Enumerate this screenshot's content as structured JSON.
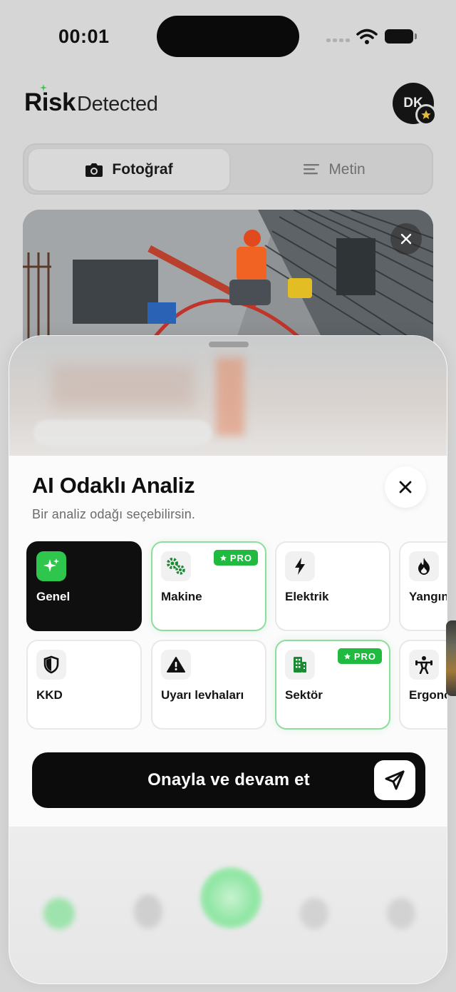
{
  "status_bar": {
    "time": "00:01"
  },
  "header": {
    "logo_part1": "Risk",
    "logo_part2": "Detected",
    "avatar_initials": "DK"
  },
  "segmented": {
    "photo_label": "Fotoğraf",
    "text_label": "Metin"
  },
  "sheet": {
    "title": "AI Odaklı Analiz",
    "subtitle": "Bir analiz odağı seçebilirsin.",
    "options": [
      {
        "label": "Genel",
        "icon": "sparkles-icon",
        "selected": true,
        "pro": false
      },
      {
        "label": "Makine",
        "icon": "gears-icon",
        "selected": false,
        "pro": true
      },
      {
        "label": "Elektrik",
        "icon": "bolt-icon",
        "selected": false,
        "pro": false
      },
      {
        "label": "Yangın",
        "icon": "flame-icon",
        "selected": false,
        "pro": false
      },
      {
        "label": "KKD",
        "icon": "shield-icon",
        "selected": false,
        "pro": false
      },
      {
        "label": "Uyarı levhaları",
        "icon": "warning-icon",
        "selected": false,
        "pro": false
      },
      {
        "label": "Sektör",
        "icon": "building-icon",
        "selected": false,
        "pro": true
      },
      {
        "label": "Ergonomi",
        "icon": "person-lifting-icon",
        "selected": false,
        "pro": false
      }
    ],
    "pro_label": "PRO",
    "confirm_label": "Onayla ve devam et"
  },
  "colors": {
    "accent_green": "#2ec64d",
    "pro_green": "#1fba3f",
    "dark": "#0f0f0f"
  }
}
